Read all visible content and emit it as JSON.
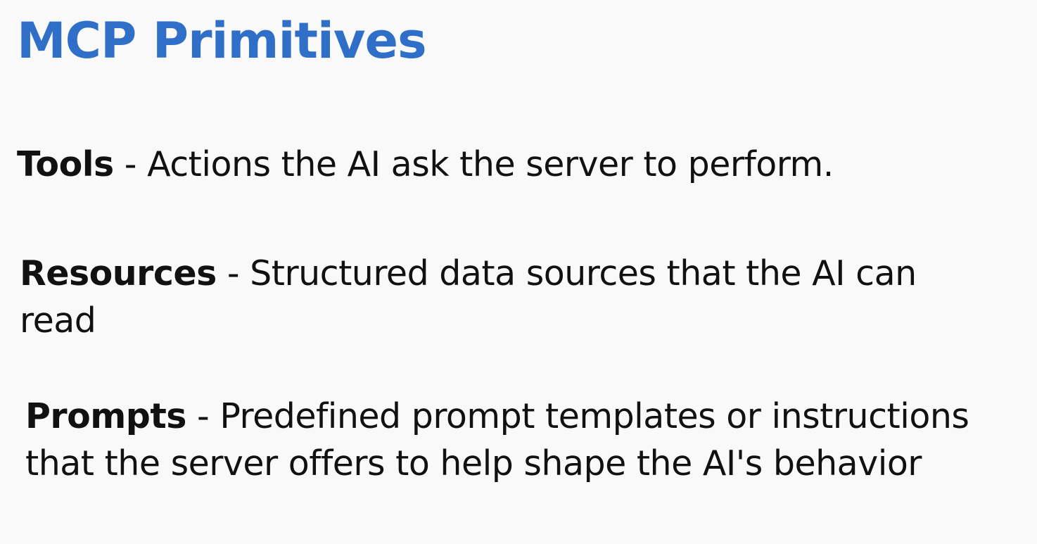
{
  "slide": {
    "title": "MCP Primitives",
    "title_color": "#2f6fc8",
    "text_color": "#111111",
    "background": "#f9f9f9",
    "separator": " - ",
    "items": [
      {
        "term": "Tools",
        "description": "Actions the AI ask the server to perform."
      },
      {
        "term": "Resources",
        "description": "Structured data sources that the AI can read"
      },
      {
        "term": "Prompts",
        "description": "Predefined prompt templates or instructions that the server offers to help shape the AI's behavior"
      }
    ]
  }
}
